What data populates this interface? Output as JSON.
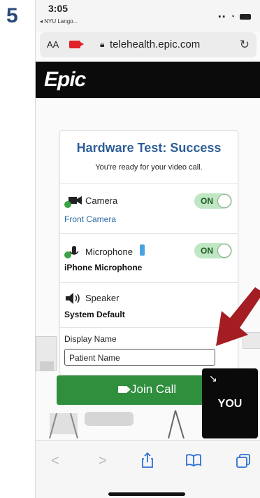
{
  "step": {
    "number": "5"
  },
  "status_bar": {
    "time": "3:05",
    "back_label": "◂ NYU Lango..."
  },
  "browser": {
    "text_size": "AA",
    "url": "telehealth.epic.com",
    "reload_icon": "reload-icon"
  },
  "app": {
    "logo": "Epic"
  },
  "hardware_test": {
    "title": "Hardware Test: Success",
    "subtitle": "You're ready for your video call.",
    "camera": {
      "label": "Camera",
      "device": "Front Camera",
      "toggle": "ON"
    },
    "microphone": {
      "label": "Microphone",
      "device": "iPhone Microphone",
      "toggle": "ON"
    },
    "speaker": {
      "label": "Speaker",
      "device": "System Default"
    },
    "display_name": {
      "label": "Display Name",
      "value": "Patient Name"
    }
  },
  "join": {
    "label": "Join Call"
  },
  "self_view": {
    "label": "YOU",
    "expand_icon": "↘"
  },
  "toolbar": {
    "back": "<",
    "forward": ">",
    "share_icon": "share-icon",
    "bookmarks_icon": "bookmarks-icon",
    "tabs_icon": "tabs-icon"
  },
  "colors": {
    "title_blue": "#2e5f98",
    "join_green": "#2f8f3d",
    "toggle_green": "#bfe7c4",
    "arrow_red": "#a31d22",
    "header_black": "#0b0b0b"
  }
}
